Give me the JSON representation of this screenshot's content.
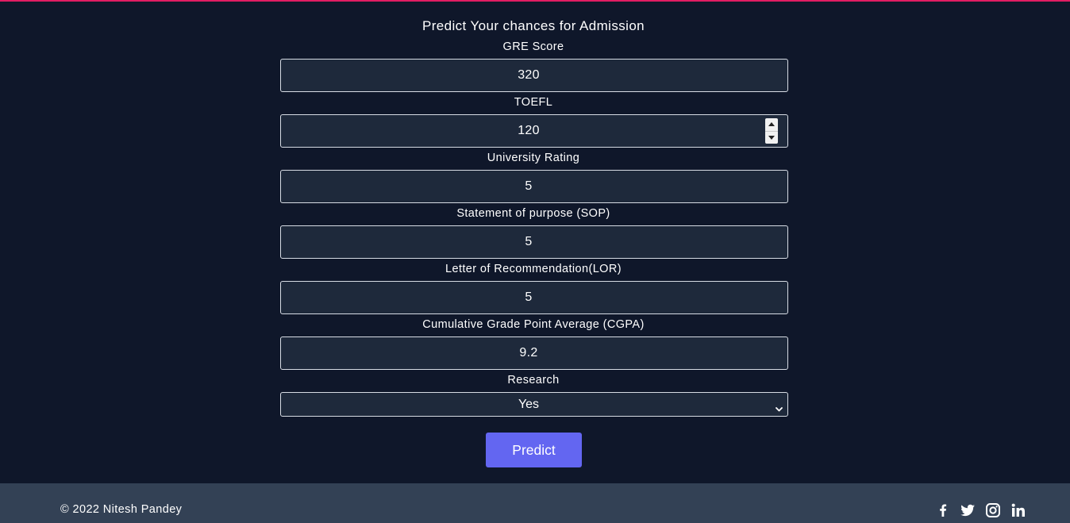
{
  "form": {
    "title": "Predict Your chances for Admission",
    "fields": [
      {
        "label": "GRE Score",
        "value": "320"
      },
      {
        "label": "TOEFL",
        "value": "120"
      },
      {
        "label": "University Rating",
        "value": "5"
      },
      {
        "label": "Statement of purpose (SOP)",
        "value": "5"
      },
      {
        "label": "Letter of Recommendation(LOR)",
        "value": "5"
      },
      {
        "label": "Cumulative Grade Point Average (CGPA)",
        "value": "9.2"
      }
    ],
    "research": {
      "label": "Research",
      "selected": "Yes"
    },
    "submit_label": "Predict"
  },
  "footer": {
    "copyright": "© 2022 Nitesh Pandey",
    "social_icons": [
      "facebook-icon",
      "twitter-icon",
      "instagram-icon",
      "linkedin-icon"
    ]
  },
  "colors": {
    "background": "#0f172a",
    "input_background": "#1e293b",
    "button": "#6366f1",
    "footer": "#334155",
    "top_accent": "#e11d63"
  }
}
